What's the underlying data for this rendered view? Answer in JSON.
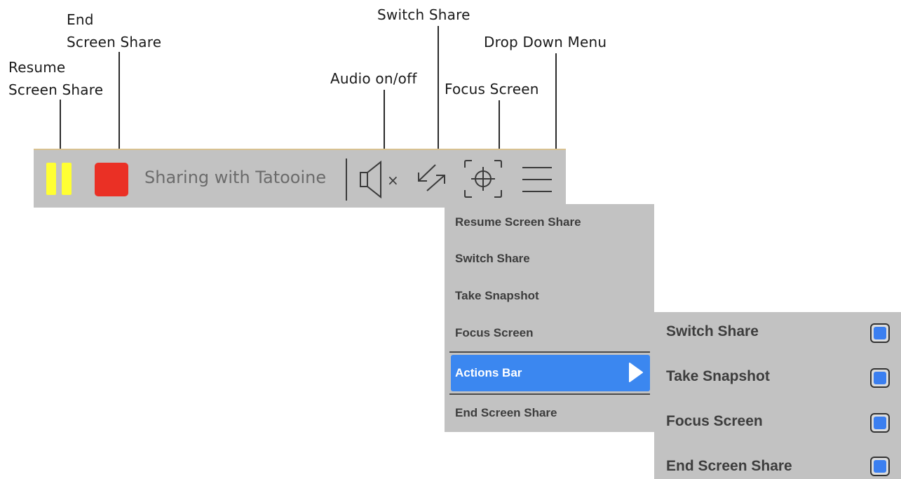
{
  "annotations": {
    "resume": [
      "Resume",
      "Screen Share"
    ],
    "end": [
      "End",
      "Screen Share"
    ],
    "audio": "Audio on/off",
    "switch": "Switch Share",
    "focus": "Focus Screen",
    "dropdown": "Drop Down Menu"
  },
  "toolbar": {
    "pause_icon": "pause-icon",
    "stop_icon": "stop-icon",
    "status_text": "Sharing with Tatooine",
    "audio_icon": "speaker-muted-icon",
    "audio_mute_glyph": "×",
    "switch_icon": "switch-arrows-icon",
    "focus_icon": "crosshair-icon",
    "menu_icon": "hamburger-icon"
  },
  "menu": {
    "items": [
      "Resume Screen Share",
      "Switch Share",
      "Take Snapshot",
      "Focus Screen"
    ],
    "active_item": "Actions Bar",
    "last_item": "End Screen Share"
  },
  "submenu": {
    "items": [
      {
        "label": "Switch Share",
        "checked": true
      },
      {
        "label": "Take Snapshot",
        "checked": true
      },
      {
        "label": "Focus Screen",
        "checked": true
      },
      {
        "label": "End Screen Share",
        "checked": true
      }
    ]
  },
  "colors": {
    "pause": "#ffff33",
    "stop": "#ea3025",
    "accent": "#3b87f0",
    "bar_bg": "#c2c2c2"
  }
}
